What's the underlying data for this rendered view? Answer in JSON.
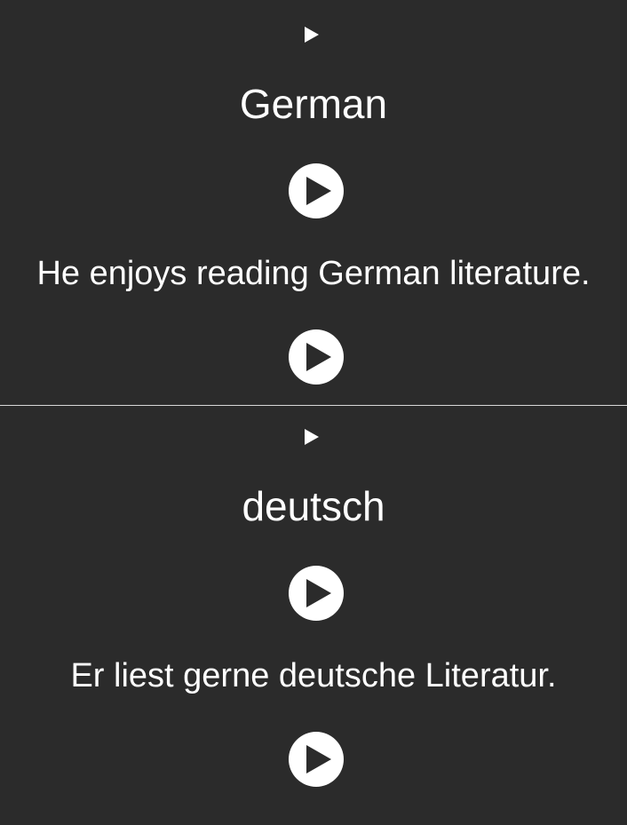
{
  "cards": {
    "front": {
      "word": "German",
      "sentence": "He enjoys reading German literature."
    },
    "back": {
      "word": "deutsch",
      "sentence": "Er liest gerne deutsche Literatur."
    }
  },
  "icons": {
    "expand": "triangle-right-icon",
    "play": "play-circle-icon"
  },
  "colors": {
    "background": "#2b2b2b",
    "text": "#ffffff",
    "divider": "#d8d8d8",
    "play_circle": "#ffffff",
    "play_triangle": "#2b2b2b"
  }
}
